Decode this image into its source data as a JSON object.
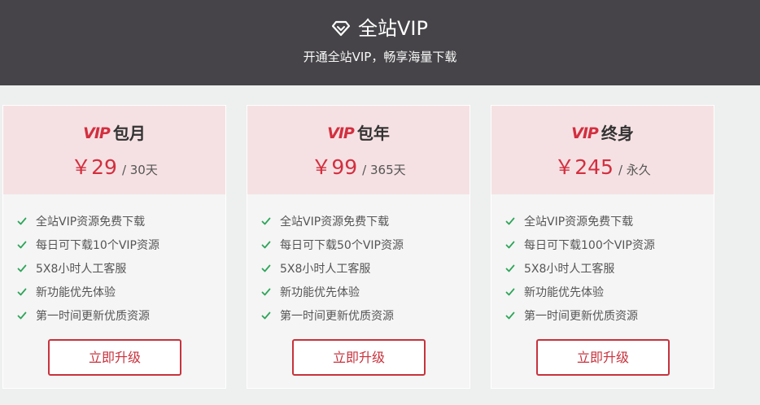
{
  "header": {
    "title": "全站VIP",
    "subtitle": "开通全站VIP，畅享海量下载",
    "icon": "diamond-icon"
  },
  "vip_logo": "VIP",
  "plans": [
    {
      "name": "包月",
      "price": "￥29",
      "period": "/ 30天",
      "features": [
        "全站VIP资源免费下载",
        "每日可下载10个VIP资源",
        "5X8小时人工客服",
        "新功能优先体验",
        "第一时间更新优质资源"
      ],
      "button": "立即升级"
    },
    {
      "name": "包年",
      "price": "￥99",
      "period": "/ 365天",
      "features": [
        "全站VIP资源免费下载",
        "每日可下载50个VIP资源",
        "5X8小时人工客服",
        "新功能优先体验",
        "第一时间更新优质资源"
      ],
      "button": "立即升级"
    },
    {
      "name": "终身",
      "price": "￥245",
      "period": "/ 永久",
      "features": [
        "全站VIP资源免费下载",
        "每日可下载100个VIP资源",
        "5X8小时人工客服",
        "新功能优先体验",
        "第一时间更新优质资源"
      ],
      "button": "立即升级"
    }
  ],
  "colors": {
    "header_bg": "#464448",
    "accent": "#d32f3f",
    "card_top_bg": "#f5e1e3",
    "check": "#2ea55a"
  }
}
